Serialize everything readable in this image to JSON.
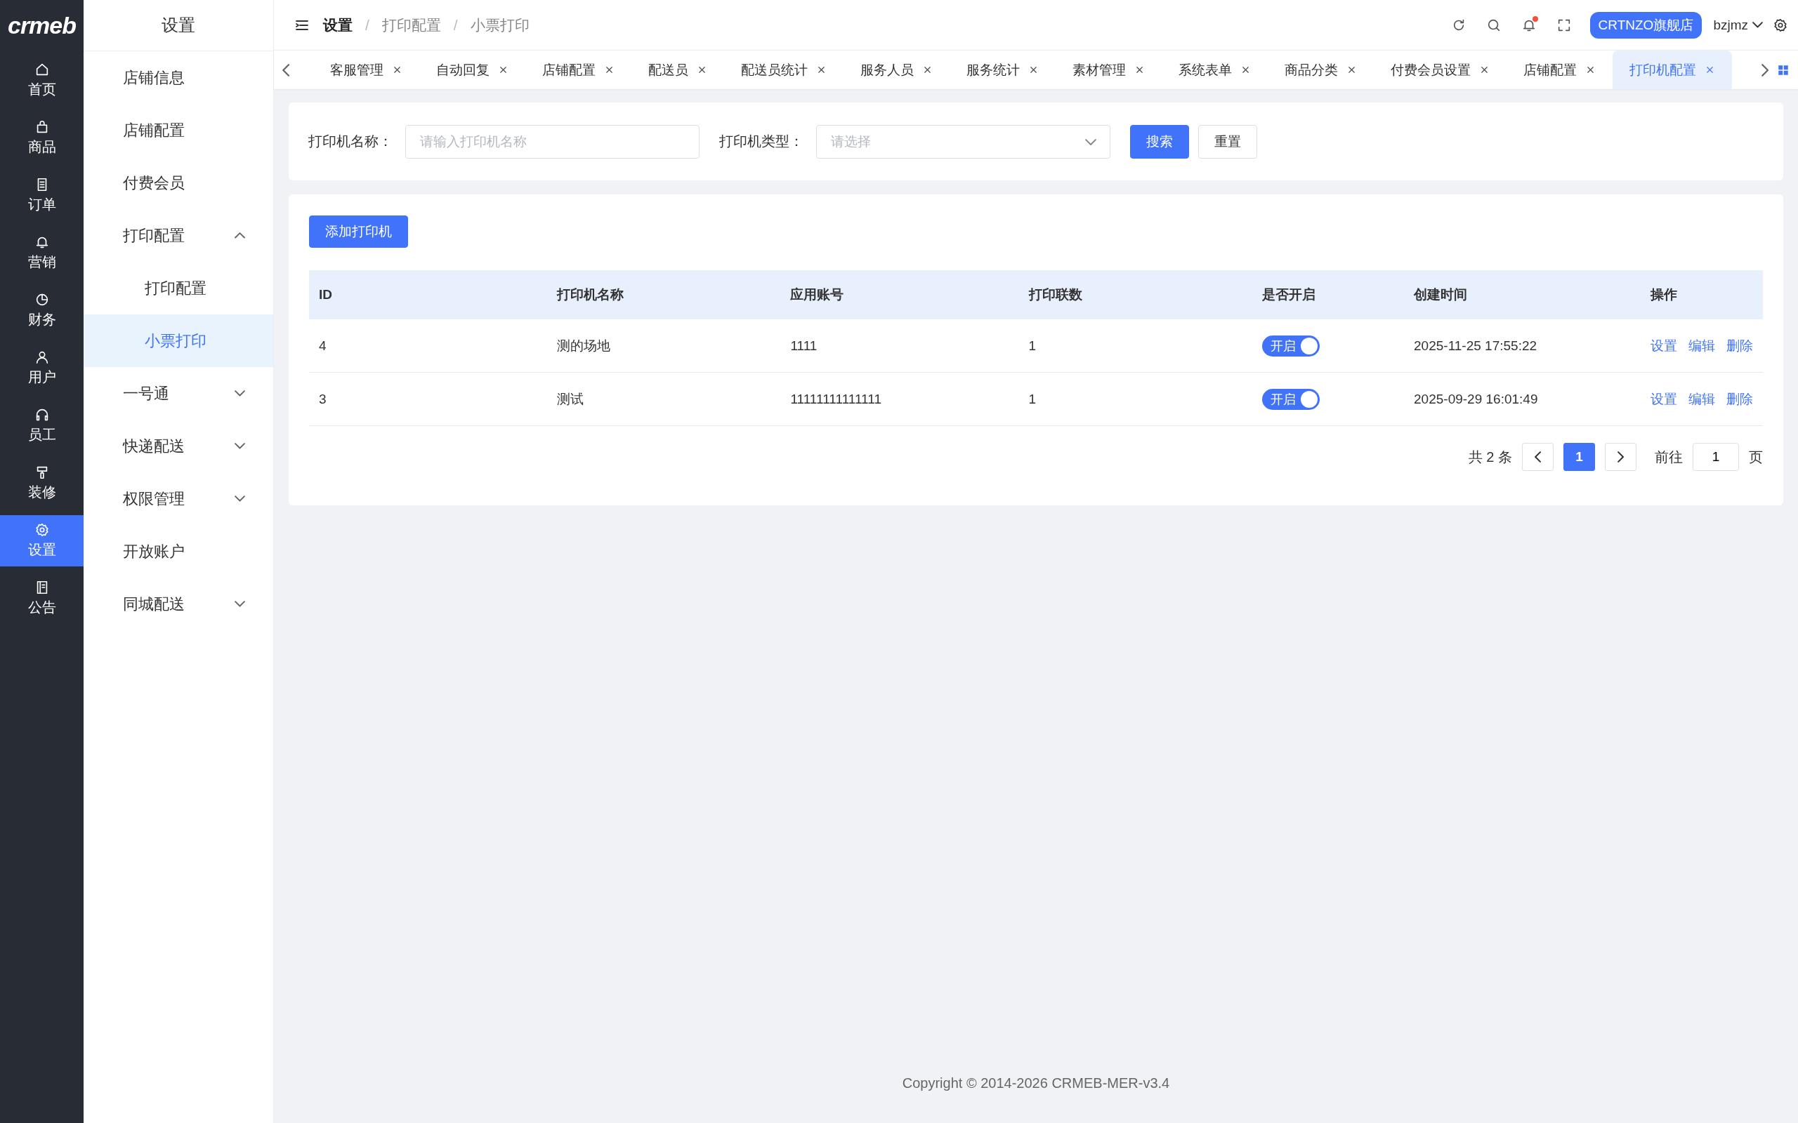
{
  "logo": "crmeb",
  "rail": [
    {
      "label": "首页",
      "selected": false
    },
    {
      "label": "商品",
      "selected": false
    },
    {
      "label": "订单",
      "selected": false
    },
    {
      "label": "营销",
      "selected": false
    },
    {
      "label": "财务",
      "selected": false
    },
    {
      "label": "用户",
      "selected": false
    },
    {
      "label": "员工",
      "selected": false
    },
    {
      "label": "装修",
      "selected": false
    },
    {
      "label": "设置",
      "selected": true
    },
    {
      "label": "公告",
      "selected": false
    }
  ],
  "submenu": {
    "title": "设置",
    "items": [
      {
        "label": "店铺信息",
        "selected": false
      },
      {
        "label": "店铺配置",
        "selected": false
      },
      {
        "label": "付费会员",
        "selected": false
      },
      {
        "label": "打印配置",
        "selected": false,
        "expanded": true,
        "children": [
          {
            "label": "打印配置",
            "selected": false
          },
          {
            "label": "小票打印",
            "selected": true
          }
        ]
      },
      {
        "label": "一号通",
        "selected": false,
        "expanded": false
      },
      {
        "label": "快递配送",
        "selected": false,
        "expanded": false
      },
      {
        "label": "权限管理",
        "selected": false,
        "expanded": false
      },
      {
        "label": "开放账户",
        "selected": false
      },
      {
        "label": "同城配送",
        "selected": false,
        "expanded": false
      }
    ]
  },
  "header": {
    "breadcrumb": [
      "设置",
      "打印配置",
      "小票打印"
    ],
    "breadcrumb_separator": "/",
    "notification_dot": true,
    "store_button": "CRTNZO旗舰店",
    "user": "bzjmz"
  },
  "tabs": [
    {
      "label": "客服管理",
      "selected": false
    },
    {
      "label": "自动回复",
      "selected": false
    },
    {
      "label": "店铺配置",
      "selected": false
    },
    {
      "label": "配送员",
      "selected": false
    },
    {
      "label": "配送员统计",
      "selected": false
    },
    {
      "label": "服务人员",
      "selected": false
    },
    {
      "label": "服务统计",
      "selected": false
    },
    {
      "label": "素材管理",
      "selected": false
    },
    {
      "label": "系统表单",
      "selected": false
    },
    {
      "label": "商品分类",
      "selected": false
    },
    {
      "label": "付费会员设置",
      "selected": false
    },
    {
      "label": "店铺配置",
      "selected": false
    },
    {
      "label": "打印机配置",
      "selected": true
    }
  ],
  "filters": {
    "fields": [
      {
        "label": "打印机名称：",
        "placeholder": "请输入打印机名称",
        "kind": "text"
      },
      {
        "label": "打印机类型：",
        "placeholder": "请选择",
        "kind": "select"
      }
    ],
    "buttons": [
      {
        "label": "搜索",
        "kind": "primary"
      },
      {
        "label": "重置",
        "kind": "default"
      }
    ]
  },
  "table": {
    "add_button": "添加打印机",
    "columns": [
      "ID",
      "打印机名称",
      "应用账号",
      "打印联数",
      "是否开启",
      "创建时间",
      "操作"
    ],
    "rows": [
      {
        "cells": [
          "4",
          "测的场地",
          "1111",
          "1"
        ],
        "switch": {
          "on": true,
          "label": "开启"
        },
        "created": "2025-11-25 17:55:22",
        "actions": [
          "设置",
          "编辑",
          "删除"
        ]
      },
      {
        "cells": [
          "3",
          "测试",
          "11111111111111",
          "1"
        ],
        "switch": {
          "on": true,
          "label": "开启"
        },
        "created": "2025-09-29 16:01:49",
        "actions": [
          "设置",
          "编辑",
          "删除"
        ]
      }
    ]
  },
  "pagination": {
    "total": "共 2 条",
    "pages": [
      {
        "label": "1",
        "selected": true
      }
    ],
    "goto_label": "前往",
    "goto_value": "1",
    "page_suffix": "页"
  },
  "footer": "Copyright © 2014-2026 CRMEB-MER-v3.4"
}
